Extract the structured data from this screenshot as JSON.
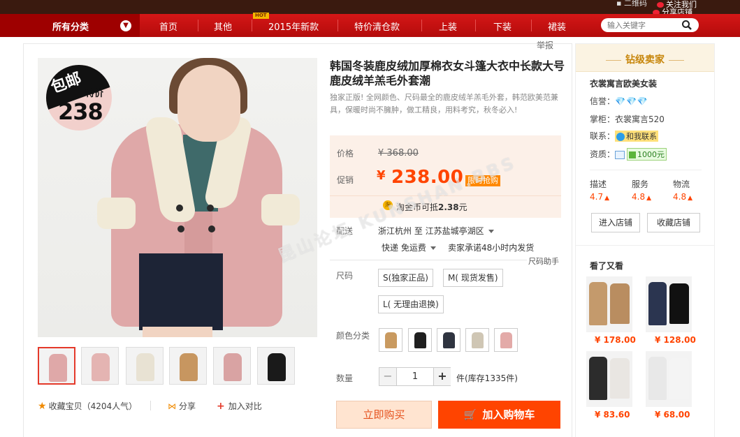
{
  "topbar": {
    "qr_label": "二维码",
    "follow_label": "关注我们",
    "share_label": "分享店铺"
  },
  "nav": {
    "all_categories": "所有分类",
    "items": [
      "首页",
      "其他",
      "2015年新款",
      "特价清仓款",
      "上装",
      "下装",
      "裙装"
    ],
    "hot_badge": "HOT",
    "search_placeholder": "输入关键字"
  },
  "report_label": "举报",
  "badge": {
    "line1": "包邮",
    "line2": "特价",
    "line3": "238"
  },
  "product": {
    "title": "韩国冬装鹿皮绒加厚棉衣女斗篷大衣中长款大号鹿皮绒羊羔毛外套潮",
    "subtitle": "独家正版! 全网颜色、尺码最全的鹿皮绒羊羔毛外套，韩范欧美范兼具，保暖时尚不臃肿，做工精良，用料考究，秋冬必入!",
    "price_label": "价格",
    "original_price": "¥ 368.00",
    "promo_label": "促销",
    "currency": "¥",
    "promo_price": "238.00",
    "flash_tag": "限时抢购",
    "coin_icon_text": "淘",
    "coin_text_prefix": "淘金币可抵",
    "coin_amount": "2.38",
    "coin_unit": "元"
  },
  "shipping": {
    "label": "配送",
    "route": "浙江杭州 至  江苏盐城亭湖区",
    "method": "快递 免运费",
    "promise": "卖家承诺48小时内发货"
  },
  "size_help": "尺码助手",
  "size": {
    "label": "尺码",
    "options": [
      "S(独家正品)",
      "M( 现货发售)",
      "L( 无理由退换)"
    ]
  },
  "color": {
    "label": "颜色分类",
    "swatches": [
      "#c99a60",
      "#1f1f1f",
      "#2f3440",
      "#cfc6b4",
      "#e3aaa8"
    ]
  },
  "quantity": {
    "label": "数量",
    "value": "1",
    "minus": "−",
    "plus": "+",
    "stock": "件(库存1335件)"
  },
  "actions": {
    "buy_now": "立即购买",
    "add_cart": "加入购物车",
    "collect": "收藏宝贝（4204人气）",
    "share": "分享",
    "compare": "加入对比"
  },
  "watermark": "昆山论坛 KUNSHAN.BBS",
  "thumbnails": [
    {
      "color": "#dfa8a8"
    },
    {
      "color": "#e4b4b2"
    },
    {
      "color": "#e8e2d3"
    },
    {
      "color": "#c79660"
    },
    {
      "color": "#d9a3a3"
    },
    {
      "color": "#1a1a1a"
    }
  ],
  "seller": {
    "grade": "钻级卖家",
    "shop_name": "衣裳寓言欧美女装",
    "credit_label": "信誉：",
    "credit_value": "💎💎💎",
    "owner_label": "掌柜：",
    "owner_value": "衣裳寓言520",
    "contact_label": "联系：",
    "contact_value": "和我联系",
    "qualification_label": "资质：",
    "deposit": "1000元",
    "scores": [
      {
        "label": "描述",
        "value": "4.7"
      },
      {
        "label": "服务",
        "value": "4.8"
      },
      {
        "label": "物流",
        "value": "4.8"
      }
    ],
    "enter_shop": "进入店铺",
    "favorite_shop": "收藏店铺"
  },
  "also_viewed": {
    "title": "看了又看",
    "items": [
      {
        "price": "¥ 178.00",
        "c1": "#c49a6c",
        "c2": "#b98d60"
      },
      {
        "price": "¥ 128.00",
        "c1": "#2b3550",
        "c2": "#111111"
      },
      {
        "price": "¥ 83.60",
        "c1": "#2c2c2c",
        "c2": "#e9e6e2"
      },
      {
        "price": "¥ 68.00",
        "c1": "#e8e8e8",
        "c2": "#f4f4f4"
      }
    ]
  }
}
